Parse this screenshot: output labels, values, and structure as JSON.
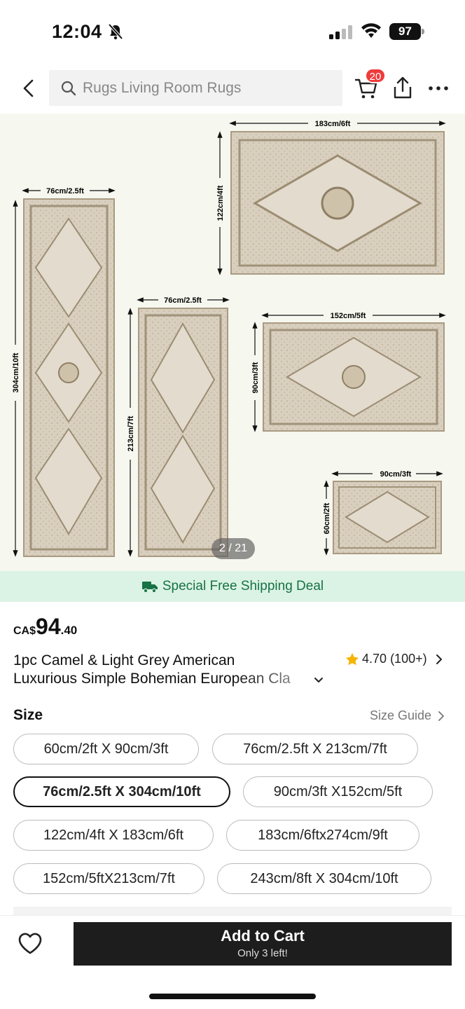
{
  "status": {
    "time": "12:04",
    "battery": "97"
  },
  "header": {
    "search_placeholder": "Rugs Living Room Rugs",
    "cart_count": "20"
  },
  "gallery": {
    "counter": "2 / 21",
    "rugs": [
      {
        "width_label": "183cm/6ft",
        "height_label": "122cm/4ft"
      },
      {
        "width_label": "76cm/2.5ft",
        "height_label": "304cm/10ft"
      },
      {
        "width_label": "76cm/2.5ft",
        "height_label": "213cm/7ft"
      },
      {
        "width_label": "152cm/5ft",
        "height_label": "90cm/3ft"
      },
      {
        "width_label": "90cm/3ft",
        "height_label": "60cm/2ft"
      }
    ]
  },
  "shipping": {
    "text": "Special Free Shipping Deal"
  },
  "price": {
    "currency": "CA$",
    "integer": "94",
    "decimal": ".40"
  },
  "product": {
    "title_line1": "1pc Camel & Light Grey American",
    "title_line2": "Luxurious Simple Bohemian European Cla",
    "rating": "4.70",
    "reviews": "(100+)"
  },
  "size": {
    "label": "Size",
    "guide": "Size Guide",
    "options": [
      "60cm/2ft X 90cm/3ft",
      "76cm/2.5ft X 213cm/7ft",
      "76cm/2.5ft X 304cm/10ft",
      "90cm/3ft X152cm/5ft",
      "122cm/4ft X 183cm/6ft",
      "183cm/6ftx274cm/9ft",
      "152cm/5ftX213cm/7ft",
      "243cm/8ft X 304cm/10ft"
    ],
    "selected": "76cm/2.5ft X 304cm/10ft"
  },
  "cart_bar": {
    "button": "Add to Cart",
    "stock": "Only 3 left!"
  },
  "colors": {
    "shipping_bg": "#dbf3e4",
    "shipping_text": "#177245",
    "badge": "#ee3b3b",
    "star": "#f5b400",
    "button_bg": "#1d1d1d"
  }
}
